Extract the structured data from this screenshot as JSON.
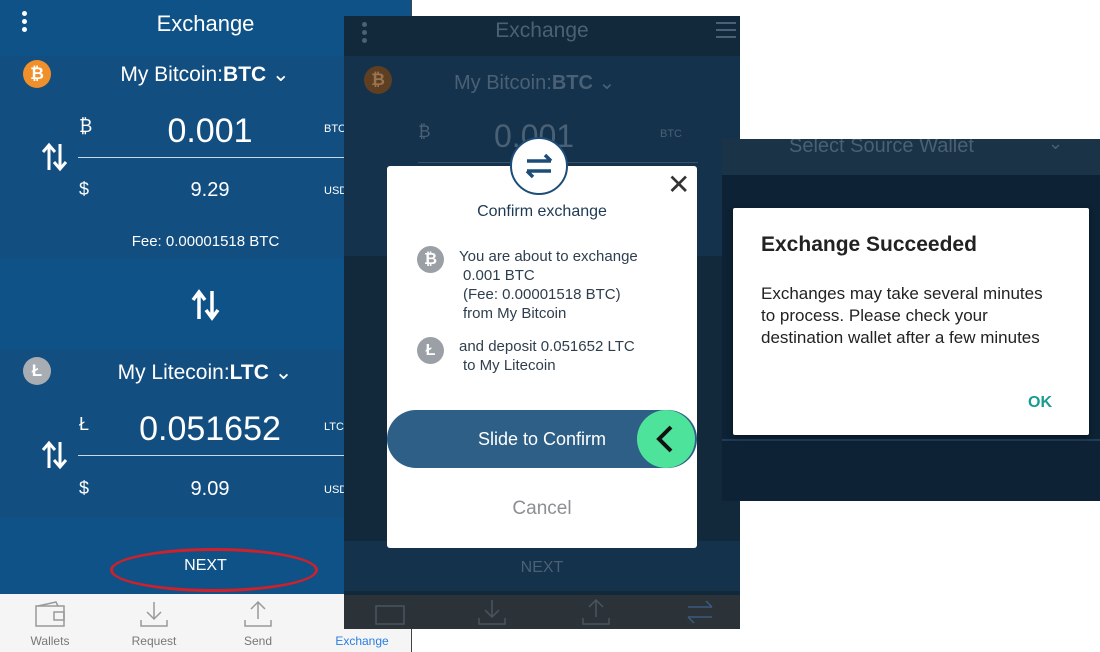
{
  "screen1": {
    "title": "Exchange",
    "source": {
      "wallet_name": "My Bitcoin:",
      "ticker": "BTC",
      "coin_symbol": "₿",
      "crypto_amount": "0.001",
      "crypto_unit": "BTC",
      "fiat_symbol": "$",
      "fiat_amount": "9.29",
      "fiat_unit": "USD",
      "fee": "Fee:  0.00001518 BTC"
    },
    "dest": {
      "wallet_name": "My Litecoin:",
      "ticker": "LTC",
      "coin_symbol": "Ł",
      "crypto_amount": "0.051652",
      "crypto_unit": "LTC",
      "fiat_symbol": "$",
      "fiat_amount": "9.09",
      "fiat_unit": "USD"
    },
    "next_label": "NEXT",
    "tabs": [
      {
        "label": "Wallets",
        "icon": "wallet-icon"
      },
      {
        "label": "Request",
        "icon": "download-icon"
      },
      {
        "label": "Send",
        "icon": "upload-icon"
      },
      {
        "label": "Exchange",
        "icon": "exchange-icon",
        "active": true
      }
    ],
    "highlight_color": "#d0202a",
    "accent": "#2a7de1"
  },
  "screen2": {
    "title": "Exchange",
    "source_wallet": "My Bitcoin:",
    "source_ticker": "BTC",
    "amount": "0.001",
    "amount_unit": "BTC",
    "next_label": "NEXT",
    "dialog": {
      "title": "Confirm exchange",
      "line1": "You are about to exchange",
      "line2": "0.001 BTC",
      "line3": "(Fee:  0.00001518 BTC)",
      "line4": "from My Bitcoin",
      "line5": "and deposit 0.051652 LTC",
      "line6": "to My Litecoin",
      "slide_label": "Slide to Confirm",
      "cancel_label": "Cancel"
    },
    "slider_color": "#2e5f86",
    "knob_color": "#4ee39a"
  },
  "screen3": {
    "header": "Select Source Wallet",
    "dialog": {
      "title": "Exchange Succeeded",
      "body": "Exchanges may take several minutes to process. Please check your destination wallet after a few minutes",
      "ok_label": "OK"
    },
    "ok_color": "#179c8f"
  }
}
